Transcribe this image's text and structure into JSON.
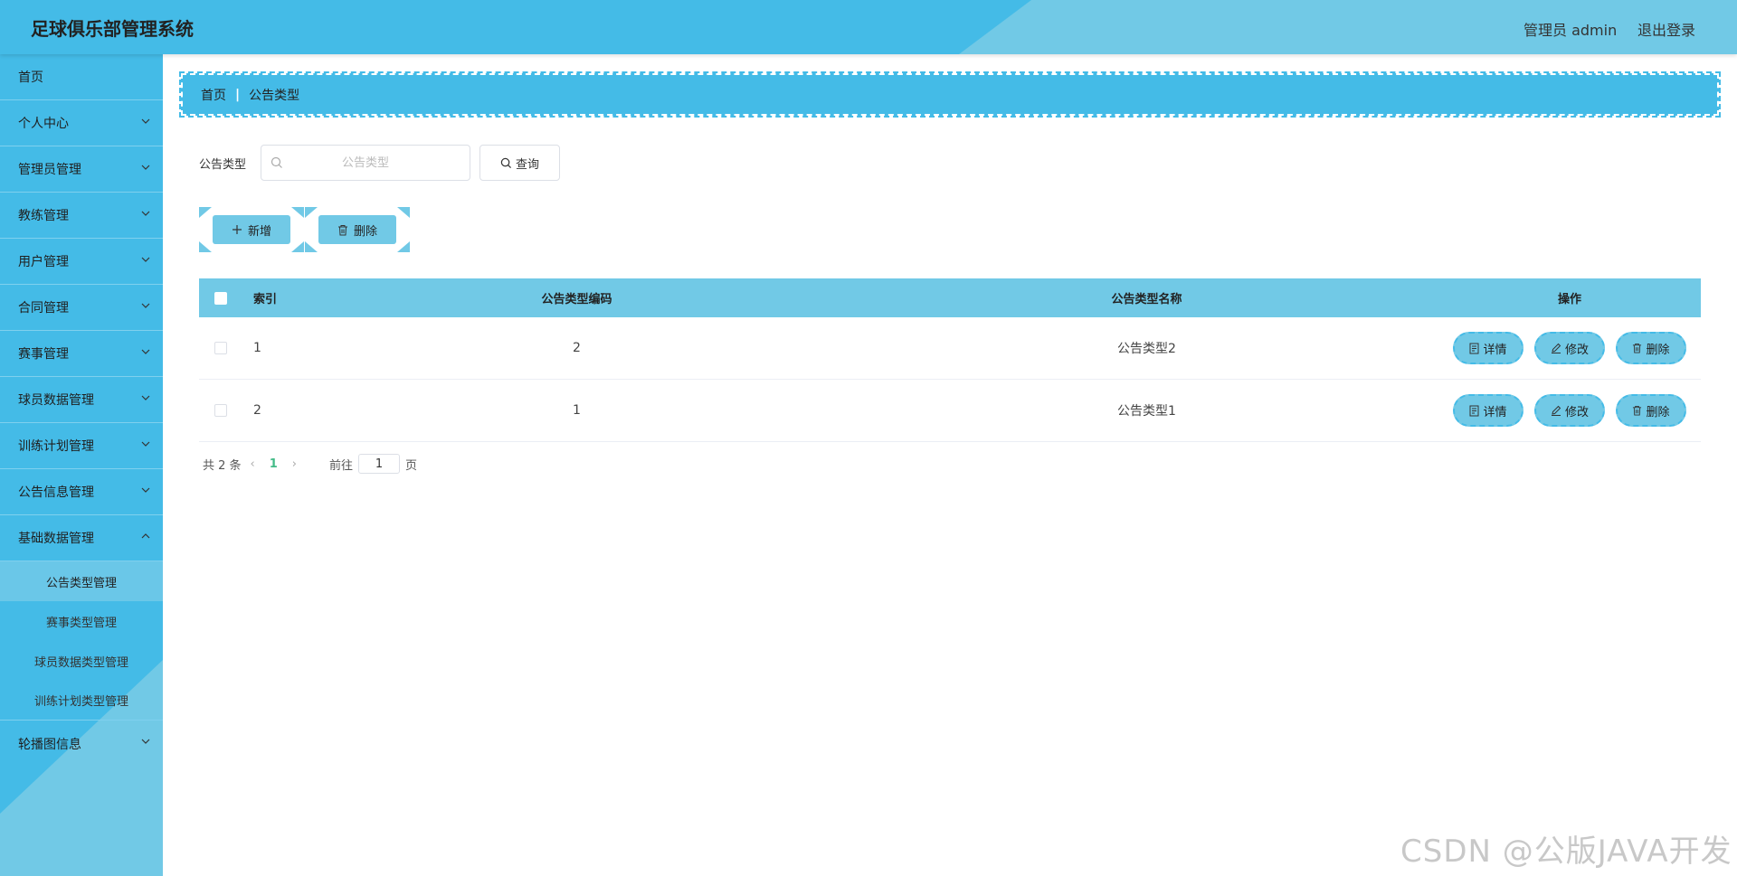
{
  "header": {
    "title": "足球俱乐部管理系统",
    "user": "管理员 admin",
    "logout": "退出登录"
  },
  "sidebar": {
    "items": [
      {
        "label": "首页"
      },
      {
        "label": "个人中心"
      },
      {
        "label": "管理员管理"
      },
      {
        "label": "教练管理"
      },
      {
        "label": "用户管理"
      },
      {
        "label": "合同管理"
      },
      {
        "label": "赛事管理"
      },
      {
        "label": "球员数据管理"
      },
      {
        "label": "训练计划管理"
      },
      {
        "label": "公告信息管理"
      },
      {
        "label": "基础数据管理"
      }
    ],
    "sub_items": [
      {
        "label": "公告类型管理"
      },
      {
        "label": "赛事类型管理"
      },
      {
        "label": "球员数据类型管理"
      },
      {
        "label": "训练计划类型管理"
      }
    ],
    "last_item": {
      "label": "轮播图信息"
    }
  },
  "breadcrumb": {
    "home": "首页",
    "current": "公告类型"
  },
  "search": {
    "label": "公告类型",
    "placeholder": "公告类型",
    "query_label": "查询"
  },
  "actions": {
    "add_label": "新增",
    "delete_label": "删除"
  },
  "table": {
    "headers": {
      "index": "索引",
      "code": "公告类型编码",
      "name": "公告类型名称",
      "ops": "操作"
    },
    "rows": [
      {
        "index": "1",
        "code": "2",
        "name": "公告类型2"
      },
      {
        "index": "2",
        "code": "1",
        "name": "公告类型1"
      }
    ],
    "ops": {
      "detail": "详情",
      "edit": "修改",
      "delete": "删除"
    }
  },
  "pagination": {
    "total": "共 2 条",
    "current_page": "1",
    "goto_label": "前往",
    "goto_value": "1",
    "page_suffix": "页"
  },
  "watermark": "CSDN @公版JAVA开发",
  "colors": {
    "primary": "#44bbe7",
    "secondary": "#71c9e6",
    "pager_active": "#44bb88"
  }
}
